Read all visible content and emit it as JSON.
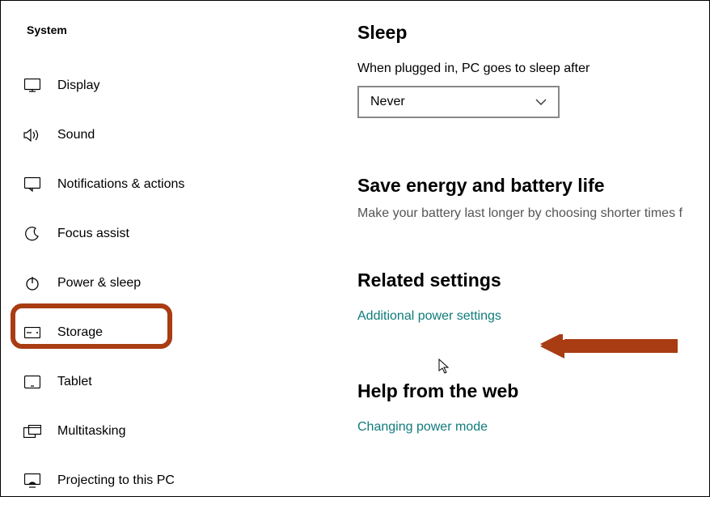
{
  "sidebar": {
    "title": "System",
    "items": [
      {
        "label": "Display"
      },
      {
        "label": "Sound"
      },
      {
        "label": "Notifications & actions"
      },
      {
        "label": "Focus assist"
      },
      {
        "label": "Power & sleep"
      },
      {
        "label": "Storage"
      },
      {
        "label": "Tablet"
      },
      {
        "label": "Multitasking"
      },
      {
        "label": "Projecting to this PC"
      }
    ]
  },
  "main": {
    "sleep": {
      "heading": "Sleep",
      "label": "When plugged in, PC goes to sleep after",
      "value": "Never"
    },
    "energy": {
      "heading": "Save energy and battery life",
      "subtext": "Make your battery last longer by choosing shorter times f"
    },
    "related": {
      "heading": "Related settings",
      "link": "Additional power settings"
    },
    "help": {
      "heading": "Help from the web",
      "link": "Changing power mode"
    }
  }
}
